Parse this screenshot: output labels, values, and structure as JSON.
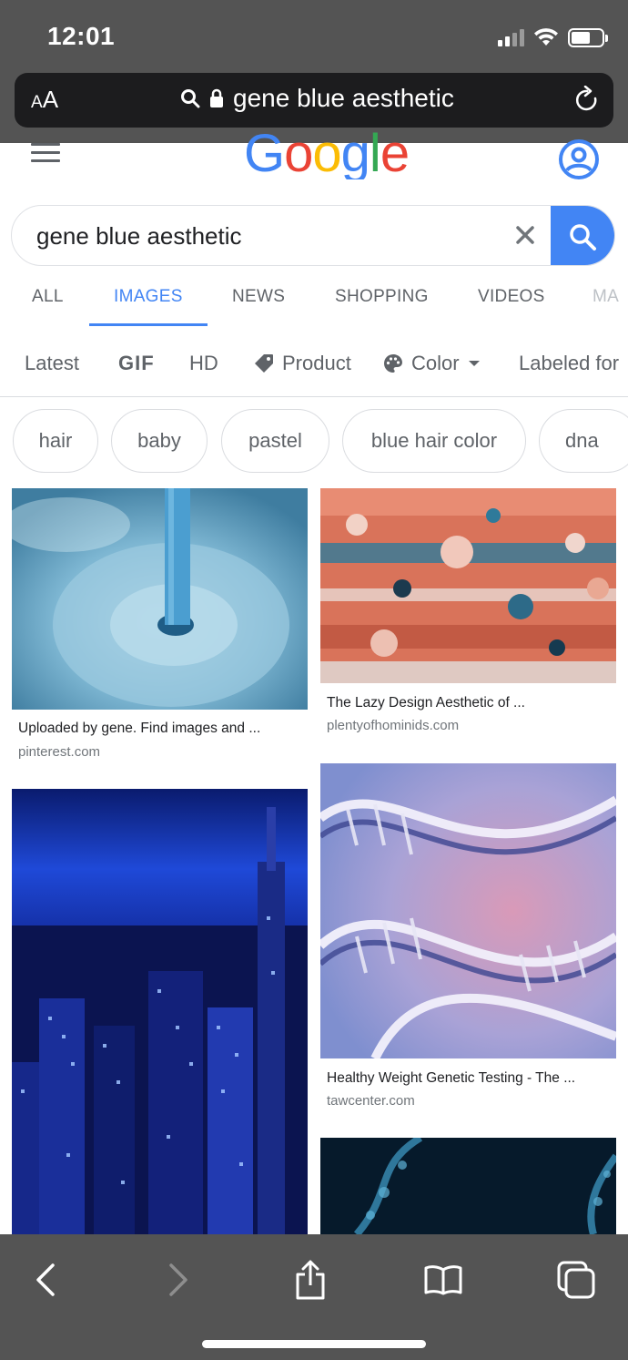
{
  "status_bar": {
    "time": "12:01"
  },
  "browser": {
    "text_size_label_small": "A",
    "text_size_label_large": "A",
    "url_text": "gene blue aesthetic"
  },
  "google": {
    "search_query": "gene blue aesthetic",
    "tabs": [
      "ALL",
      "IMAGES",
      "NEWS",
      "SHOPPING",
      "VIDEOS",
      "MA"
    ],
    "active_tab": "IMAGES",
    "filters": {
      "latest": "Latest",
      "gif": "GIF",
      "hd": "HD",
      "product": "Product",
      "color": "Color",
      "labeled": "Labeled for"
    },
    "chips": [
      "hair",
      "baby",
      "pastel",
      "blue hair color",
      "dna"
    ],
    "results": [
      {
        "caption": "Uploaded by gene. Find images and ...",
        "domain": "pinterest.com"
      },
      {
        "caption": "The Lazy Design Aesthetic of ...",
        "domain": "plentyofhominids.com"
      },
      {
        "caption": "Healthy Weight Genetic Testing - The ...",
        "domain": "tawcenter.com"
      }
    ]
  },
  "colors": {
    "google_blue": "#4285F4",
    "google_red": "#EA4335",
    "google_yellow": "#FBBC05",
    "google_green": "#34A853",
    "safari_chrome": "#545454"
  }
}
